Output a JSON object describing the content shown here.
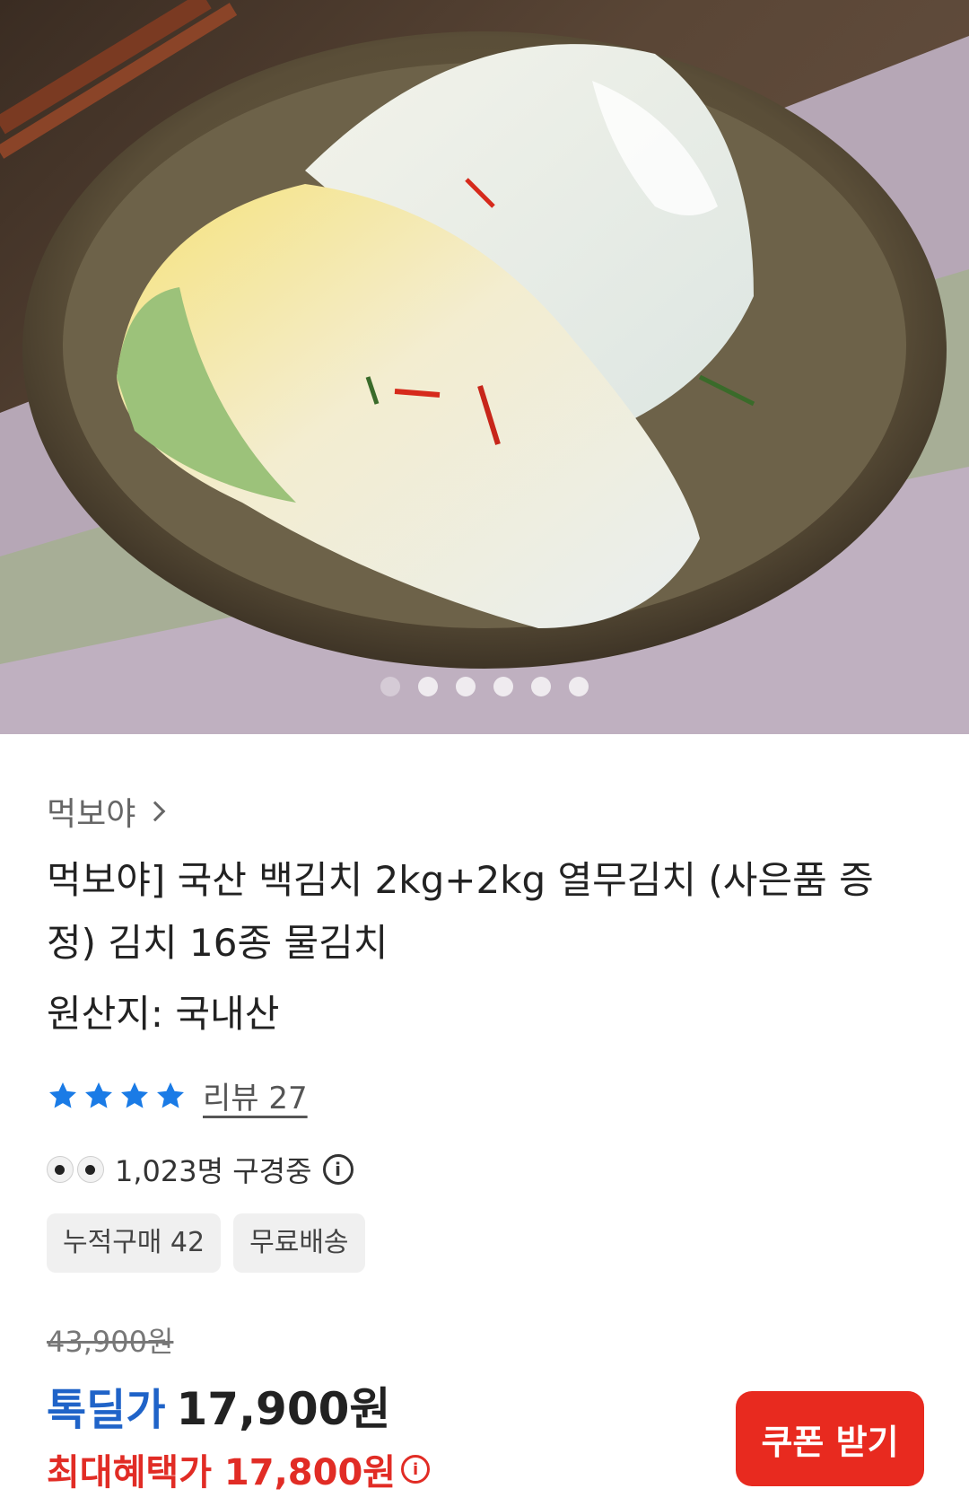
{
  "carousel": {
    "slide_count": 6,
    "active_index": 0
  },
  "seller": {
    "name": "먹보야"
  },
  "product": {
    "title": "먹보야] 국산 백김치 2kg+2kg 열무김치 (사은품 증정) 김치 16종 물김치",
    "origin": "원산지: 국내산"
  },
  "rating": {
    "stars": 4,
    "review_label": "리뷰 27"
  },
  "watching": {
    "text": "1,023명 구경중",
    "info_icon": "i"
  },
  "tags": [
    "누적구매 42",
    "무료배송"
  ],
  "price": {
    "original": "43,900원",
    "deal_label": "톡딜가",
    "deal_price": "17,900원",
    "max_benefit": "최대혜택가 17,800원",
    "info_icon": "i"
  },
  "coupon_button": {
    "label": "쿠폰 받기"
  },
  "colors": {
    "accent_blue": "#1f63c8",
    "accent_red": "#e12c25",
    "star_blue": "#1a7be6"
  }
}
